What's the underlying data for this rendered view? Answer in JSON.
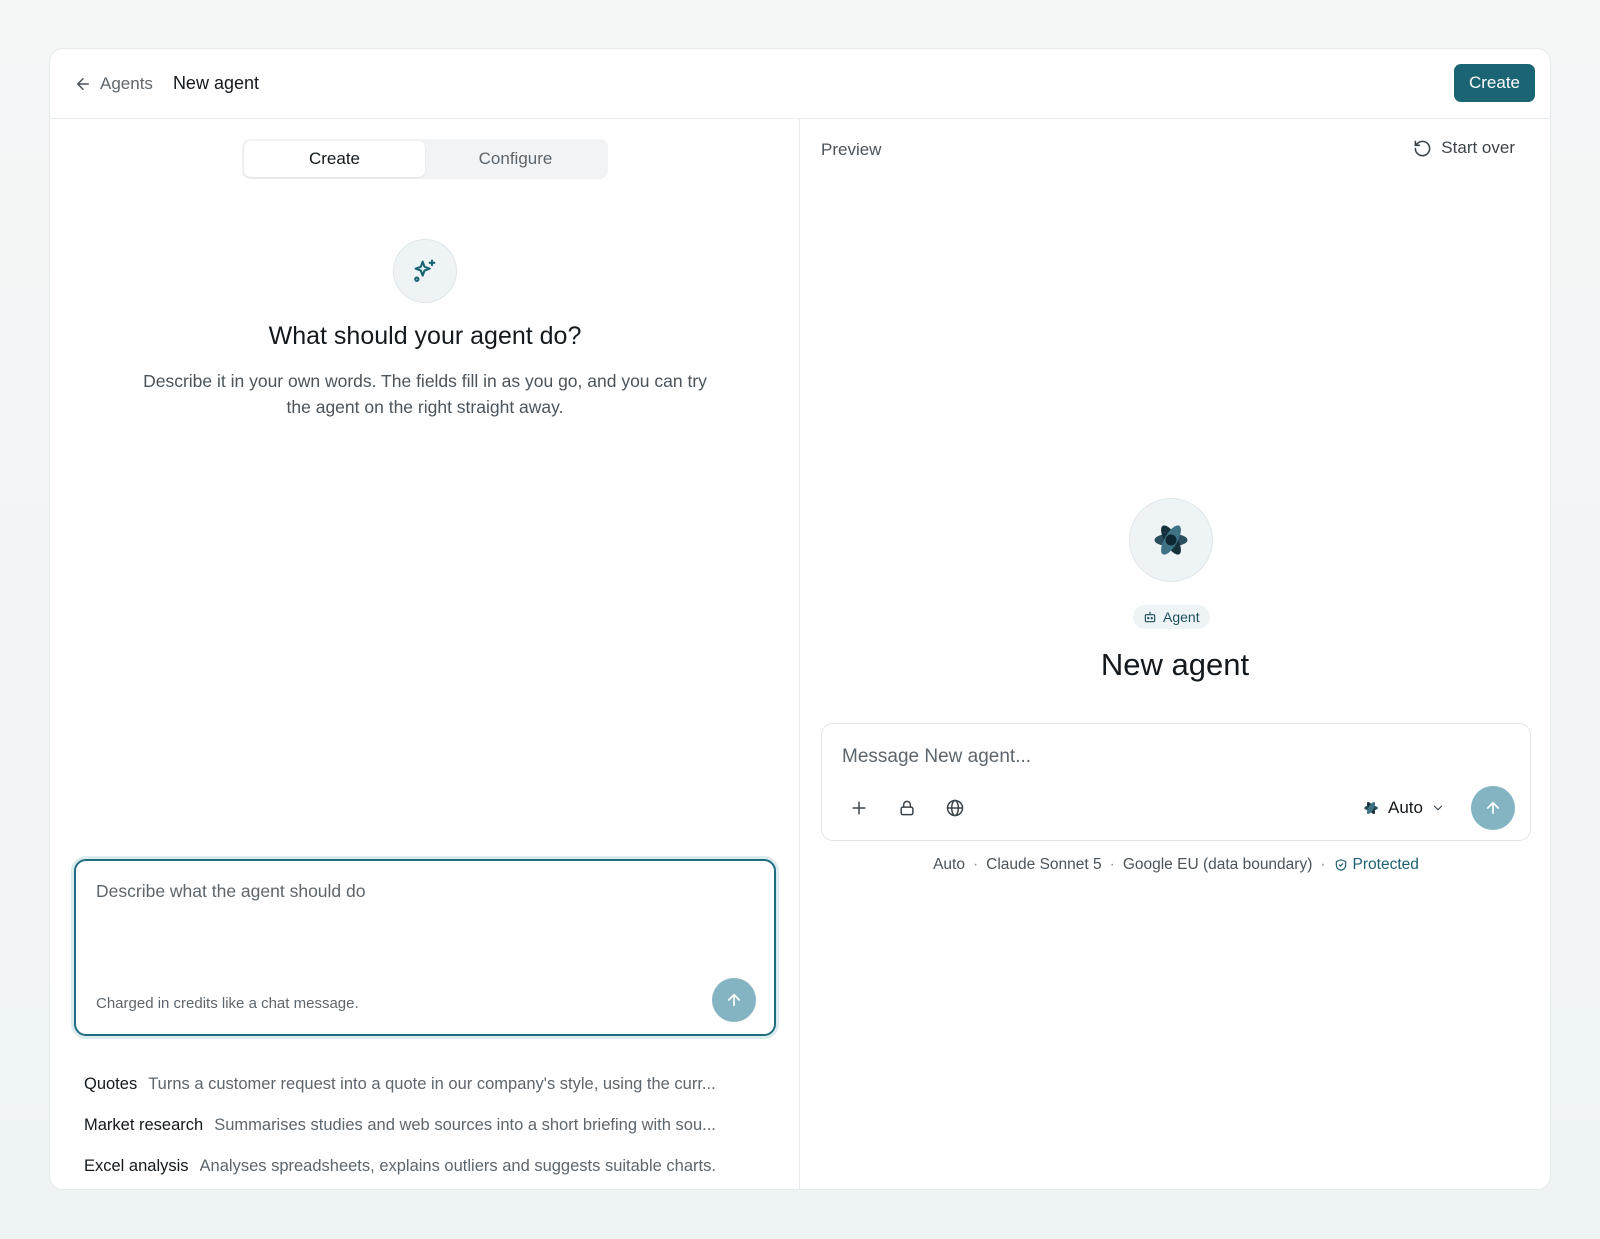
{
  "header": {
    "back_label": "Agents",
    "title": "New agent",
    "create_label": "Create"
  },
  "builder": {
    "tabs": [
      {
        "label": "Create",
        "active": true
      },
      {
        "label": "Configure",
        "active": false
      }
    ],
    "heading": "What should your agent do?",
    "subtext": "Describe it in your own words. The fields fill in as you go, and you can try the agent on the right straight away.",
    "input_placeholder": "Describe what the agent should do",
    "hint": "Charged in credits like a chat message.",
    "suggestions": [
      {
        "title": "Quotes",
        "desc": "Turns a customer request into a quote in our company's style, using the curr..."
      },
      {
        "title": "Market research",
        "desc": "Summarises studies and web sources into a short briefing with sou..."
      },
      {
        "title": "Excel analysis",
        "desc": "Analyses spreadsheets, explains outliers and suggests suitable charts."
      }
    ]
  },
  "preview": {
    "label": "Preview",
    "start_over_label": "Start over",
    "badge_label": "Agent",
    "agent_name": "New agent",
    "message_placeholder": "Message New agent...",
    "model_label": "Auto",
    "meta": {
      "mode": "Auto",
      "model": "Claude Sonnet 5",
      "region": "Google EU (data boundary)",
      "status": "Protected"
    }
  },
  "icons": {
    "back": "arrow-left-icon",
    "sparkle": "sparkles-icon",
    "restart": "rotate-ccw-icon",
    "agent": "bot-icon",
    "attach": "plus-icon",
    "lock": "lock-icon",
    "web": "globe-icon",
    "send": "arrow-up-icon",
    "dropdown": "chevron-down-icon",
    "shield": "shield-check-icon"
  },
  "colors": {
    "accent": "#1b6474",
    "send_button": "#84b4c2",
    "focus_border": "#1e6e80"
  }
}
